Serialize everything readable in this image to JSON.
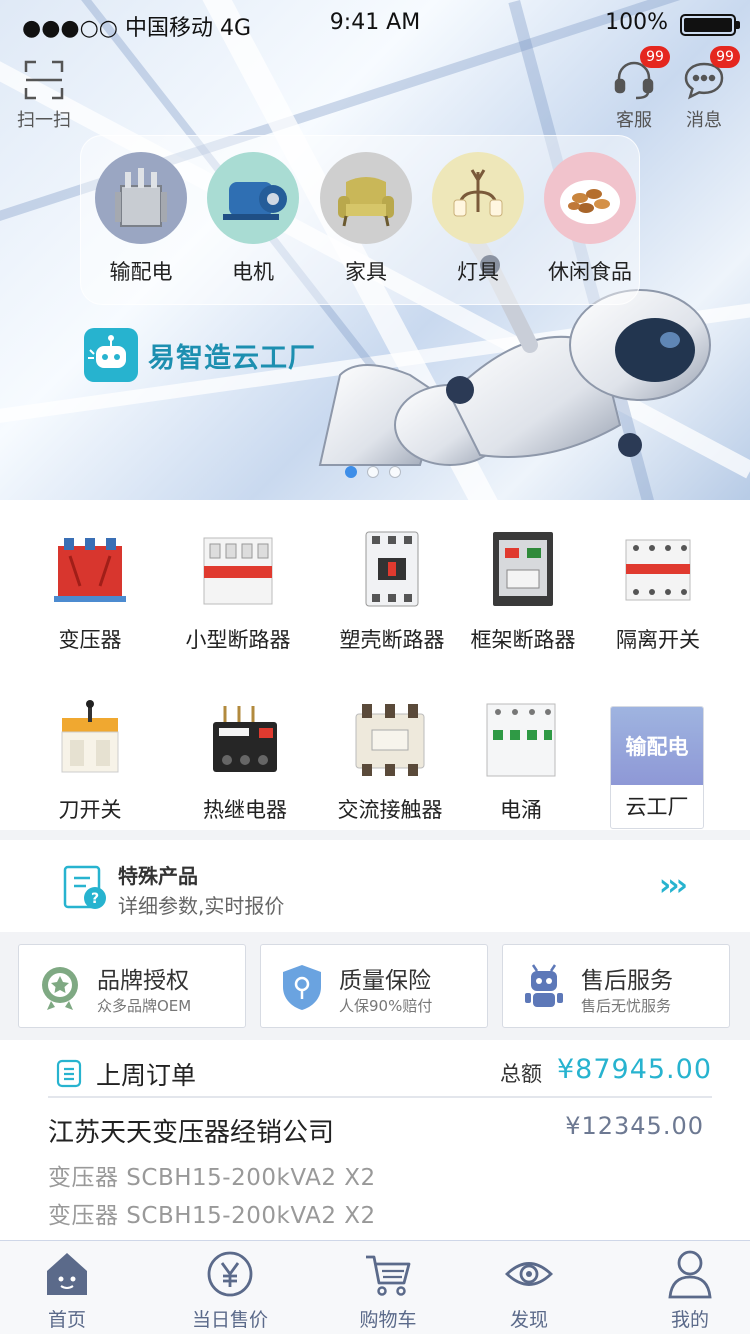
{
  "status_bar": {
    "carrier": "●●●○○ 中国移动 4G",
    "time": "9:41 AM",
    "battery": "100%"
  },
  "header": {
    "scan_label": "扫一扫",
    "service_label": "客服",
    "service_badge": "99",
    "message_label": "消息",
    "message_badge": "99"
  },
  "banner": {
    "categories": [
      {
        "label": "输配电",
        "icon": "transformer-icon",
        "bg": "#9aa6c2"
      },
      {
        "label": "电机",
        "icon": "motor-icon",
        "bg": "#a9dcd3"
      },
      {
        "label": "家具",
        "icon": "armchair-icon",
        "bg": "#cfcfcf"
      },
      {
        "label": "灯具",
        "icon": "wall-lamp-icon",
        "bg": "#eee7b9"
      },
      {
        "label": "休闲食品",
        "icon": "nuts-icon",
        "bg": "#f1c3cc"
      }
    ],
    "brand_name": "易智造云工厂",
    "slide_count": 3,
    "active_slide": 1
  },
  "products": [
    {
      "label": "变压器",
      "icon": "transformer-icon"
    },
    {
      "label": "小型断路器",
      "icon": "mini-breaker-icon"
    },
    {
      "label": "塑壳断路器",
      "icon": "mccb-icon"
    },
    {
      "label": "框架断路器",
      "icon": "acb-icon"
    },
    {
      "label": "隔离开关",
      "icon": "isolator-icon"
    },
    {
      "label": "刀开关",
      "icon": "knife-switch-icon"
    },
    {
      "label": "热继电器",
      "icon": "thermal-relay-icon"
    },
    {
      "label": "交流接触器",
      "icon": "contactor-icon"
    },
    {
      "label": "电涌",
      "icon": "surge-protector-icon"
    }
  ],
  "cloud_factory": {
    "top": "输配电",
    "bottom": "云工厂"
  },
  "special": {
    "title": "特殊产品",
    "subtitle": "详细参数,实时报价",
    "arrow": "›››"
  },
  "services": [
    {
      "title": "品牌授权",
      "subtitle": "众多品牌OEM",
      "icon": "medal-icon"
    },
    {
      "title": "质量保险",
      "subtitle": "人保90%赔付",
      "icon": "shield-icon"
    },
    {
      "title": "售后服务",
      "subtitle": "售后无忧服务",
      "icon": "robot-icon"
    }
  ],
  "orders": {
    "title": "上周订单",
    "total_label": "总额",
    "total_value": "¥87945.00",
    "company": "江苏天天变压器经销公司",
    "amount": "¥12345.00",
    "lines": [
      "变压器 SCBH15-200kVA2  X2",
      "变压器 SCBH15-200kVA2  X2"
    ]
  },
  "tabs": [
    {
      "label": "首页",
      "icon": "home-icon",
      "active": true
    },
    {
      "label": "当日售价",
      "icon": "yen-icon",
      "active": false
    },
    {
      "label": "购物车",
      "icon": "cart-icon",
      "active": false
    },
    {
      "label": "发现",
      "icon": "eye-icon",
      "active": false
    },
    {
      "label": "我的",
      "icon": "user-icon",
      "active": false
    }
  ],
  "colors": {
    "accent": "#27b3cf",
    "tab": "#5b6a8a",
    "badge": "#e5271f",
    "active_dot": "#3e8ee8"
  }
}
